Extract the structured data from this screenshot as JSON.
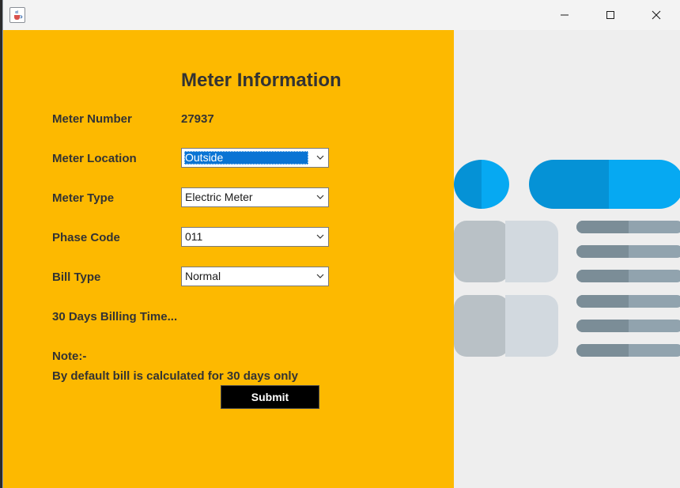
{
  "window": {
    "icon": "java-cup-icon",
    "controls": [
      "minimize-icon",
      "maximize-icon",
      "close-icon"
    ]
  },
  "form": {
    "title": "Meter Information",
    "meter_number_label": "Meter Number",
    "meter_number_value": "27937",
    "meter_location_label": "Meter Location",
    "meter_location_value": "Outside",
    "meter_type_label": "Meter Type",
    "meter_type_value": "Electric Meter",
    "phase_code_label": "Phase Code",
    "phase_code_value": "011",
    "bill_type_label": "Bill Type",
    "bill_type_value": "Normal",
    "billing_time": "30 Days Billing Time...",
    "note_title": "Note:-",
    "note_text": "By default bill is calculated for 30 days only",
    "submit_label": "Submit"
  },
  "colors": {
    "panel_bg": "#fdb900",
    "text": "#333333",
    "button_bg": "#000000",
    "illustration_blue": "#0592d6",
    "illustration_gray": "#b9c1c6"
  }
}
